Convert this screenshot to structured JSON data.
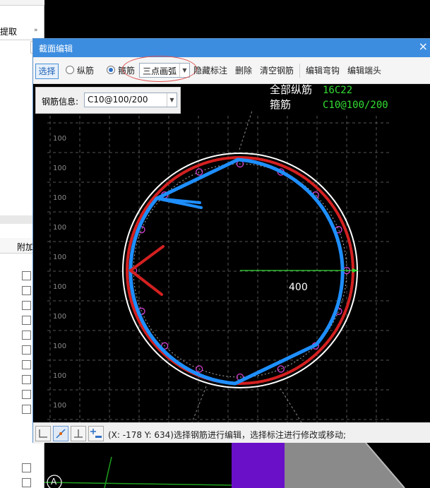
{
  "background": {
    "left_panel_top_text": "提取",
    "left_panel_header_text": "附加"
  },
  "dialog": {
    "title": "截面编辑",
    "close_glyph": "×",
    "toolbar": {
      "select_label": "选择",
      "longitudinal_label": "纵筋",
      "stirrup_label": "箍筋",
      "stirrup_selected": true,
      "draw_mode_value": "三点画弧",
      "hide_annotation_label": "隐藏标注",
      "delete_label": "删除",
      "clear_rebar_label": "清空钢筋",
      "edit_hook_label": "编辑弯钩",
      "edit_end_label": "编辑端头"
    },
    "rebar_info": {
      "label": "钢筋信息:",
      "value": "C10@100/200"
    },
    "annotations": {
      "all_longitudinal_label": "全部纵筋",
      "all_longitudinal_value": "16C22",
      "stirrup_label": "箍筋",
      "stirrup_value": "C10@100/200",
      "radius_label": "400"
    },
    "grid_labels": [
      "100",
      "100",
      "100",
      "100",
      "100",
      "100",
      "100",
      "100",
      "100",
      "100"
    ],
    "status_text": "(X: -178 Y: 634)选择钢筋进行编辑，选择标注进行修改或移动;"
  },
  "bottom": {
    "axis_label": "A"
  },
  "colors": {
    "accent": "#3c8de0",
    "circle_red": "#d42020",
    "stirrup_blue": "#1e8fff",
    "annotation_green": "#33dd33",
    "rebar_magenta": "#d040d0",
    "purple_block": "#6a10c8"
  }
}
